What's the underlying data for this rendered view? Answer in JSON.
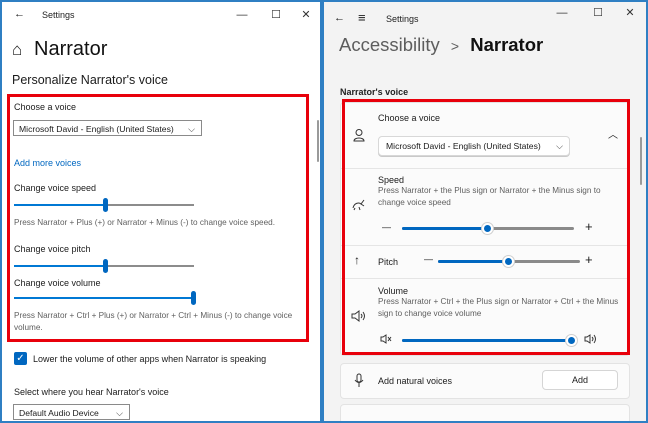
{
  "left_window": {
    "title": "Settings",
    "heading": "Narrator",
    "section_title": "Personalize Narrator's voice",
    "choose_voice_label": "Choose a voice",
    "voice_selected": "Microsoft David - English (United States)",
    "add_more_voices": "Add more voices",
    "speed_label": "Change voice speed",
    "speed_value_pct": 51,
    "speed_hint": "Press Narrator + Plus (+) or Narrator + Minus (-) to change voice speed.",
    "pitch_label": "Change voice pitch",
    "pitch_value_pct": 51,
    "volume_label": "Change voice volume",
    "volume_value_pct": 100,
    "volume_hint": "Press Narrator + Ctrl + Plus (+) or Narrator + Ctrl + Minus (-) to change voice volume.",
    "lower_volume_label": "Lower the volume of other apps when Narrator is speaking",
    "lower_volume_checked": true,
    "output_label": "Select where you hear Narrator's voice",
    "output_selected": "Default Audio Device"
  },
  "right_window": {
    "title": "Settings",
    "breadcrumb_parent": "Accessibility",
    "breadcrumb_sep": ">",
    "breadcrumb_current": "Narrator",
    "section_title": "Narrator's voice",
    "choose_voice_label": "Choose a voice",
    "voice_selected": "Microsoft David - English (United States)",
    "speed_label": "Speed",
    "speed_hint": "Press Narrator + the Plus sign or Narrator + the Minus sign to change voice speed",
    "speed_value_pct": 50,
    "pitch_label": "Pitch",
    "pitch_value_pct": 50,
    "volume_label": "Volume",
    "volume_hint": "Press Narrator + Ctrl + the Plus sign or Narrator + Ctrl + the Minus sign to change voice volume",
    "volume_value_pct": 100,
    "natural_voices_label": "Add natural voices",
    "add_button": "Add"
  },
  "glyphs": {
    "back": "←",
    "menu": "≡",
    "minimize": "—",
    "maximize": "☐",
    "close": "✕",
    "home": "⌂",
    "chevron_down": "⌵",
    "chevron_up": "︿",
    "minus": "—",
    "plus": "+",
    "check": "✓",
    "up_arrow": "↑"
  },
  "colors": {
    "accent": "#0067c0",
    "highlight": "#e8000b",
    "desktop": "#2f7fc3"
  }
}
